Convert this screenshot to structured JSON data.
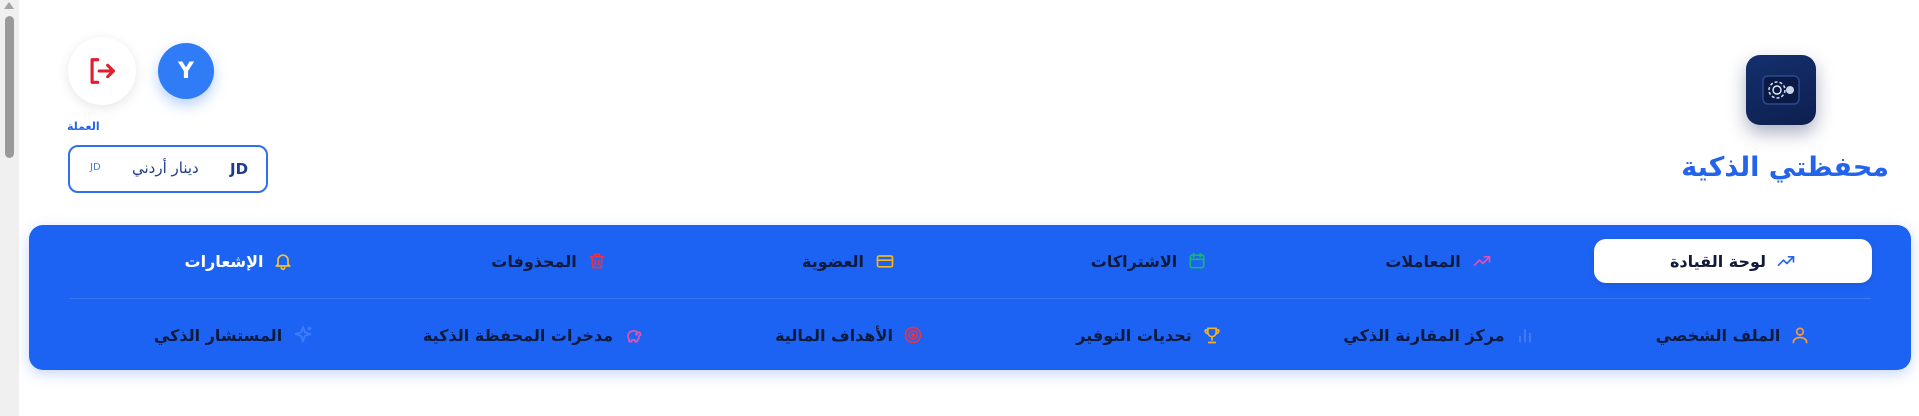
{
  "brand": {
    "title": "محفظتي الذكية"
  },
  "user": {
    "initial": "Y"
  },
  "currency": {
    "label": "العملة",
    "code": "JD",
    "name": "دينار أردني",
    "symbol": "JD"
  },
  "nav": {
    "row1": [
      {
        "label": "لوحة القيادة",
        "icon": "trend-up-icon",
        "active": true
      },
      {
        "label": "المعاملات",
        "icon": "trend-icon"
      },
      {
        "label": "الاشتراكات",
        "icon": "calendar-icon"
      },
      {
        "label": "العضوية",
        "icon": "credit-card-icon"
      },
      {
        "label": "المحذوفات",
        "icon": "trash-icon"
      },
      {
        "label": "الإشعارات",
        "icon": "bell-icon"
      }
    ],
    "row2": [
      {
        "label": "الملف الشخصي",
        "icon": "user-icon"
      },
      {
        "label": "مركز المقارنة الذكي",
        "icon": "bar-chart-icon"
      },
      {
        "label": "تحديات التوفير",
        "icon": "trophy-icon"
      },
      {
        "label": "الأهداف المالية",
        "icon": "target-icon"
      },
      {
        "label": "مدخرات المحفظة الذكية",
        "icon": "piggy-bank-icon"
      },
      {
        "label": "المستشار الذكي",
        "icon": "sparkles-icon"
      }
    ]
  },
  "colors": {
    "nav_bg": "#1d63f3",
    "accent": "#2463eb",
    "logout": "#e11d2e"
  }
}
